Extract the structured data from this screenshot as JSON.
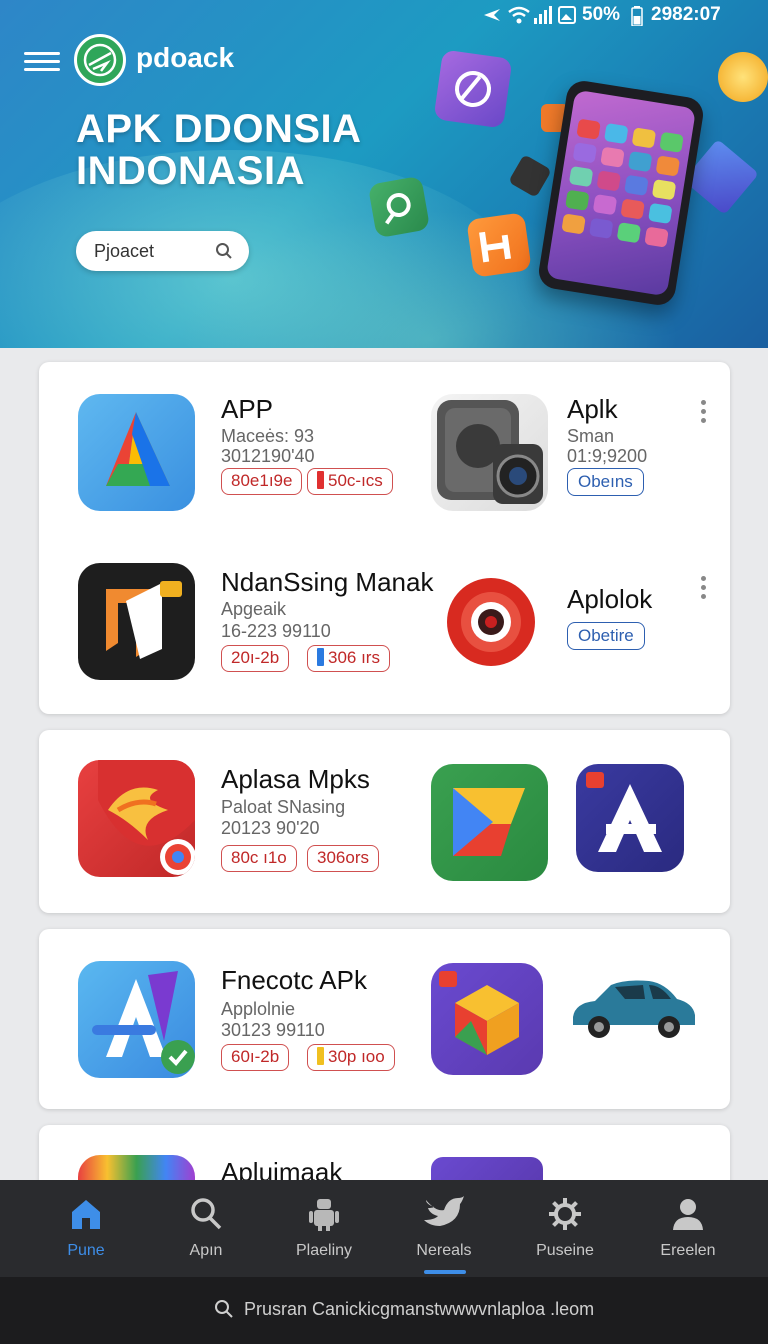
{
  "status_bar": {
    "battery": "50%",
    "time": "2982:07"
  },
  "header": {
    "brand": "pdoack",
    "title_line1": "APK DDONSIA",
    "title_line2": "INDONASIA",
    "search_placeholder": "Pjoacet"
  },
  "cards": [
    {
      "left": {
        "title": "APP",
        "line1": "Maceės: 93",
        "line2": "3012190'40",
        "tag1": "80e1ı9e",
        "tag2": "50c-ıcs"
      },
      "right": {
        "title": "Aplk",
        "line1": "Sman",
        "line2": "01:9;9200",
        "button": "Obeıns"
      }
    },
    {
      "left": {
        "title": "NdanSsing Manak",
        "line1": "Apgeaik",
        "line2": "16-223 99110",
        "tag1": "20ı-2b",
        "tag2": "306 ırs"
      },
      "right": {
        "title": "Aplolok",
        "button": "Obetire"
      }
    },
    {
      "left": {
        "title": "Aplasa Mpks",
        "line1": "Paloat SNasing",
        "line2": "20123 90'20",
        "tag1": "80c ı1o",
        "tag2": "306ors"
      }
    },
    {
      "left": {
        "title": "Fnecotc APk",
        "line1": "Applolnie",
        "line2": "30123 99110",
        "tag1": "60ı-2b",
        "tag2": "30p ıoo"
      }
    },
    {
      "left": {
        "title": "Apluimaak"
      }
    }
  ],
  "bottom_nav": [
    {
      "label": "Pune",
      "icon": "home-icon",
      "active": true
    },
    {
      "label": "Apın",
      "icon": "search-icon",
      "active": false
    },
    {
      "label": "Plaeliny",
      "icon": "robot-icon",
      "active": false
    },
    {
      "label": "Nereals",
      "icon": "bird-icon",
      "active": false
    },
    {
      "label": "Puseine",
      "icon": "gear-icon",
      "active": false
    },
    {
      "label": "Ereelen",
      "icon": "person-icon",
      "active": false
    }
  ],
  "url_bar": {
    "text": "Prusran Canickicgmanstwwwvnlaploa .leom"
  },
  "colors": {
    "accent": "#3e8ee8",
    "tag_red": "#c02828",
    "button_blue": "#2d5fb0",
    "nav_bg": "#2a2b2e"
  }
}
